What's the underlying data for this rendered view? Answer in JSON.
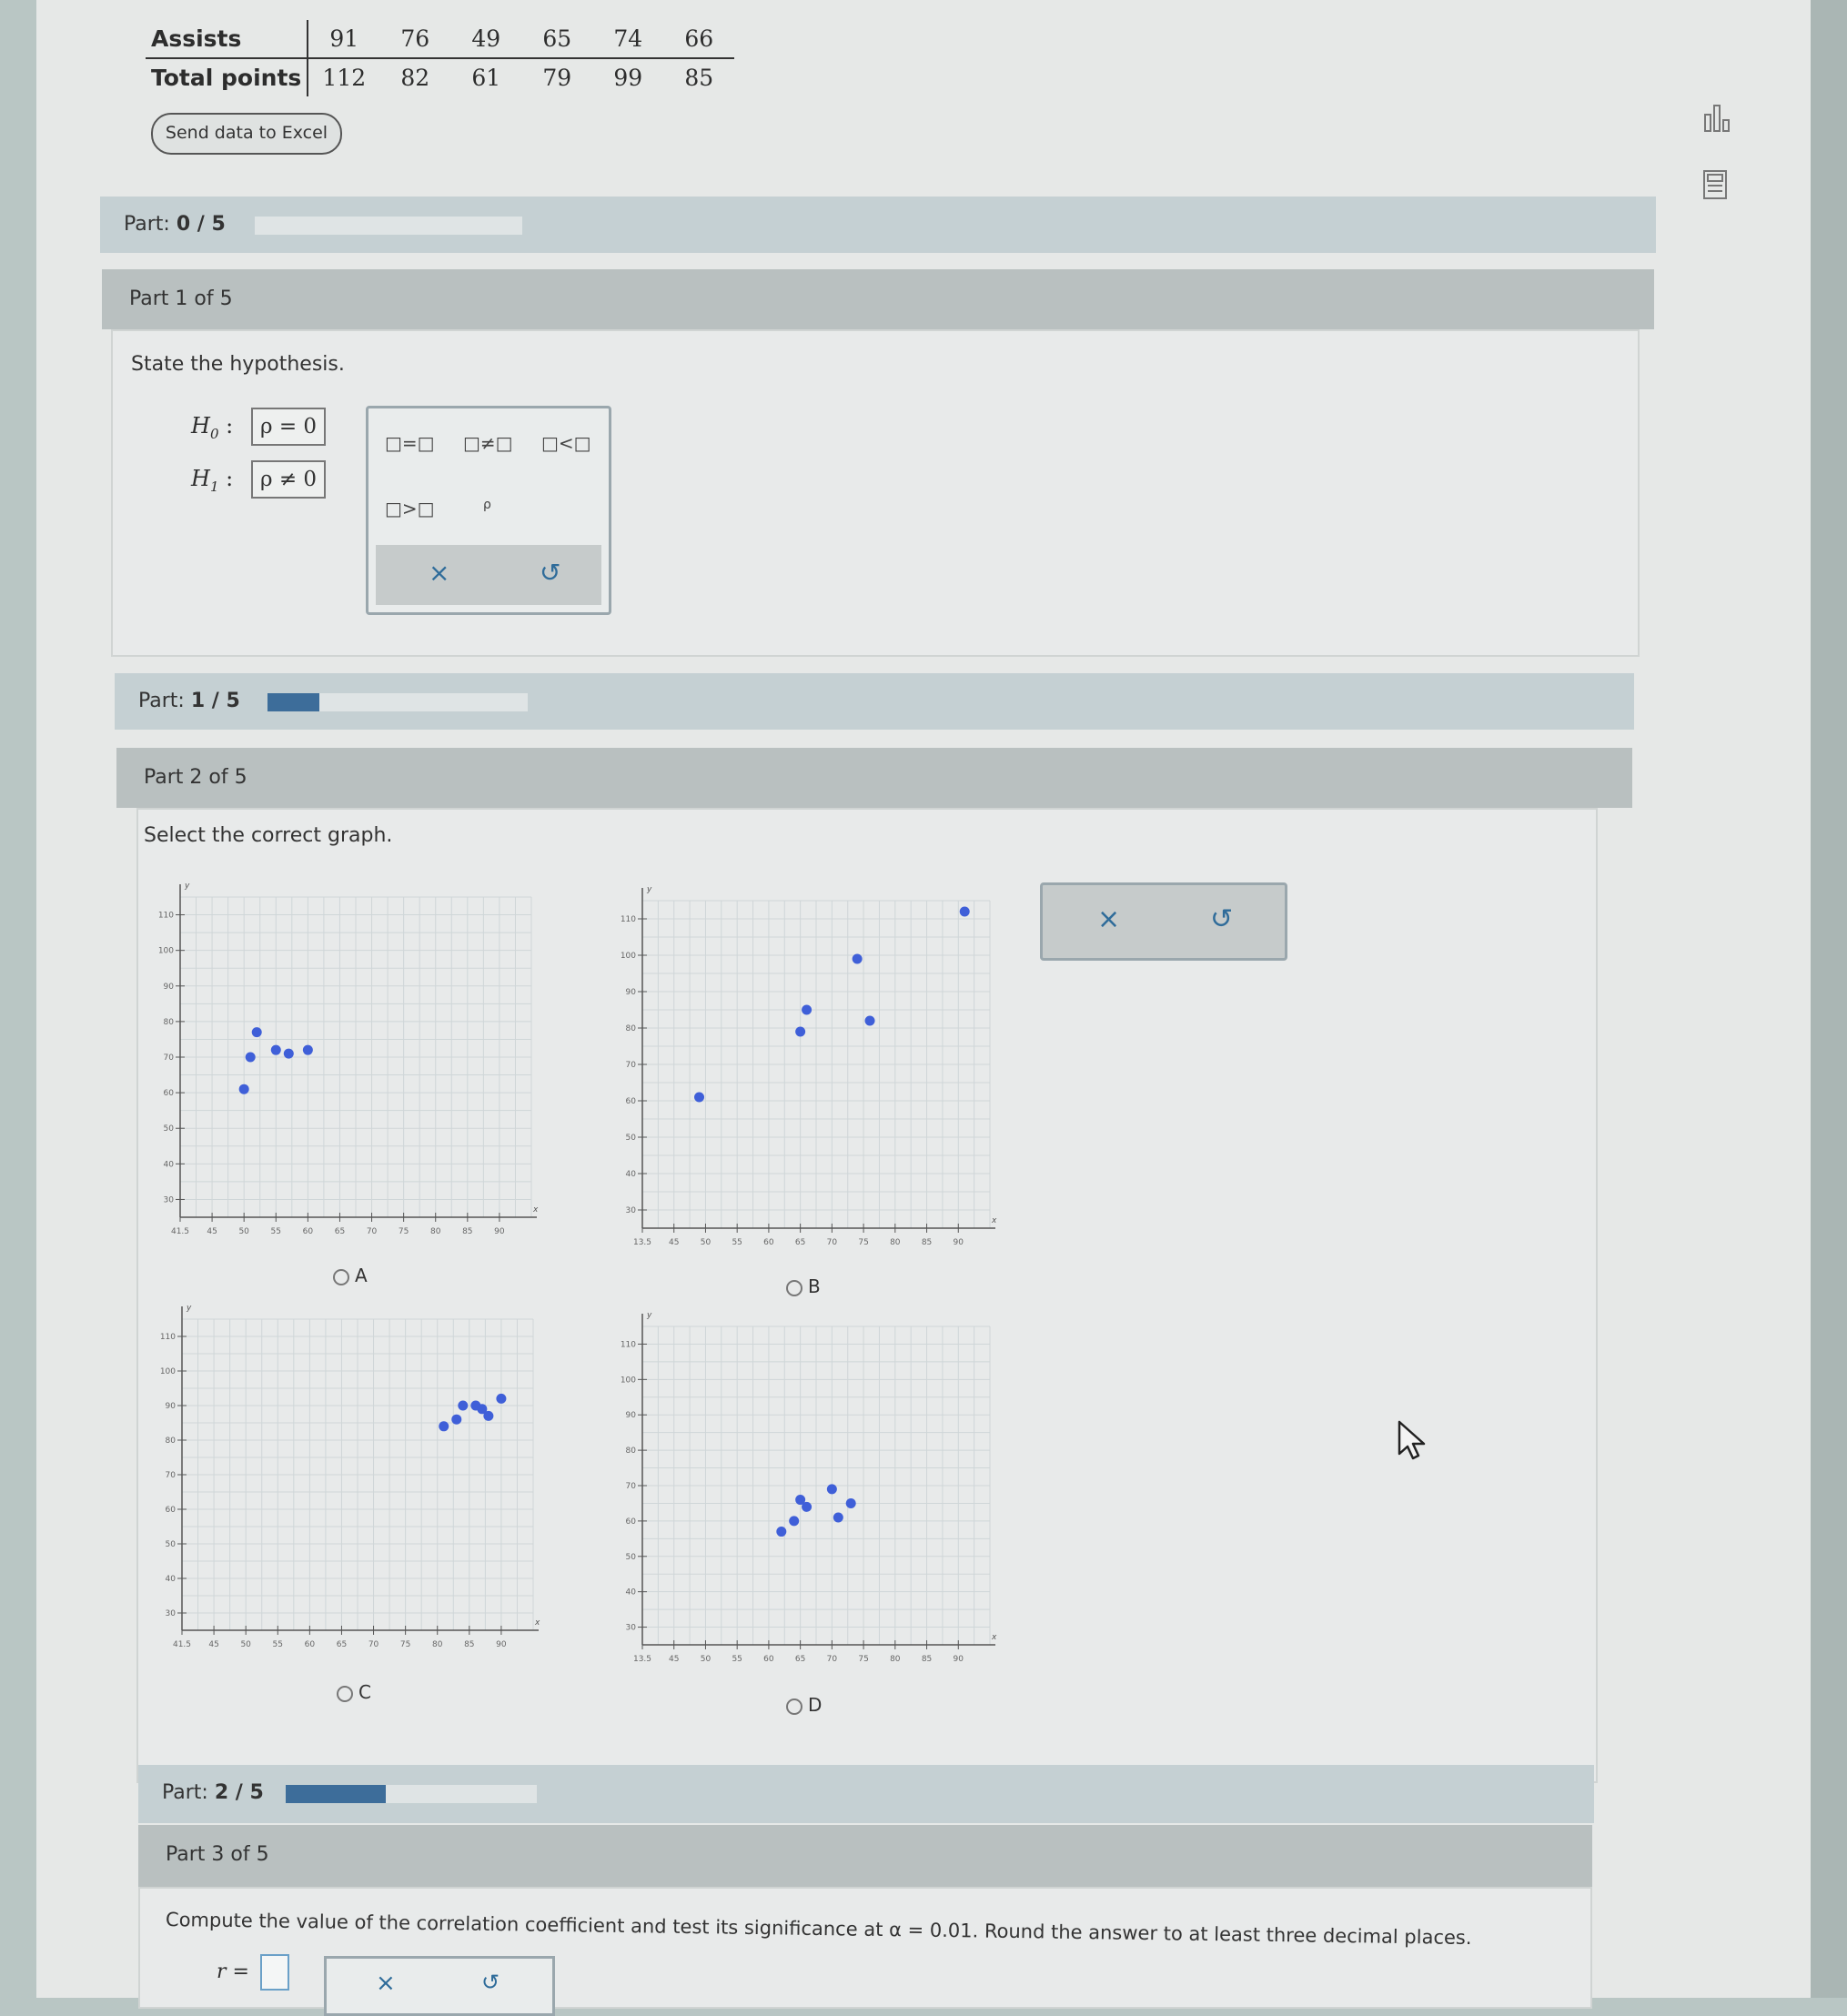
{
  "data_table": {
    "row1_label": "Assists",
    "row2_label": "Total points",
    "assists": [
      "91",
      "76",
      "49",
      "65",
      "74",
      "66"
    ],
    "total_points": [
      "112",
      "82",
      "61",
      "79",
      "99",
      "85"
    ]
  },
  "excel_button": "Send data to Excel",
  "progress": [
    {
      "prefix": "Part: ",
      "value": "0 / 5",
      "fraction": 0.0
    },
    {
      "prefix": "Part: ",
      "value": "1 / 5",
      "fraction": 0.2
    },
    {
      "prefix": "Part: ",
      "value": "2 / 5",
      "fraction": 0.4
    }
  ],
  "part1": {
    "header": "Part 1 of 5",
    "question": "State the hypothesis.",
    "h0_label": "H",
    "h0_sub": "0",
    "h0_value": "ρ = 0",
    "h1_label": "H",
    "h1_sub": "1",
    "h1_value": "ρ ≠ 0",
    "colon": ":",
    "palette": [
      "□=□",
      "□≠□",
      "□<□",
      "□>□",
      "ρ"
    ],
    "clear_icon": "×",
    "undo_icon": "↺"
  },
  "part2": {
    "header": "Part 2 of 5",
    "question": "Select the correct graph.",
    "clear_icon": "×",
    "undo_icon": "↺"
  },
  "part3": {
    "header": "Part 3 of 5",
    "question": "Compute the value of the correlation coefficient and test its significance at α = 0.01. Round the answer to at least three decimal places.",
    "r_label": "r =",
    "clear_icon": "×",
    "undo_icon": "↺"
  },
  "chart_data": [
    {
      "type": "scatter",
      "option": "A",
      "x_ticks": [
        "41.5",
        "45",
        "50",
        "55",
        "60",
        "65",
        "70",
        "75",
        "80",
        "85",
        "90"
      ],
      "y_ticks": [
        "30",
        "40",
        "50",
        "60",
        "70",
        "80",
        "90",
        "100",
        "110"
      ],
      "x_axis_label": "x",
      "y_axis_label": "y",
      "x": [
        50,
        51,
        52,
        55,
        57,
        60
      ],
      "y": [
        61,
        70,
        77,
        72,
        71,
        72
      ]
    },
    {
      "type": "scatter",
      "option": "B",
      "x_ticks": [
        "13.5",
        "45",
        "50",
        "55",
        "60",
        "65",
        "70",
        "75",
        "80",
        "85",
        "90"
      ],
      "y_ticks": [
        "30",
        "40",
        "50",
        "60",
        "70",
        "80",
        "90",
        "100",
        "110"
      ],
      "x_axis_label": "x",
      "y_axis_label": "y",
      "x": [
        49,
        65,
        66,
        74,
        76,
        91
      ],
      "y": [
        61,
        79,
        85,
        99,
        82,
        112
      ]
    },
    {
      "type": "scatter",
      "option": "C",
      "x_ticks": [
        "41.5",
        "45",
        "50",
        "55",
        "60",
        "65",
        "70",
        "75",
        "80",
        "85",
        "90"
      ],
      "y_ticks": [
        "30",
        "40",
        "50",
        "60",
        "70",
        "80",
        "90",
        "100",
        "110"
      ],
      "x_axis_label": "x",
      "y_axis_label": "y",
      "x": [
        81,
        83,
        84,
        86,
        87,
        88,
        90
      ],
      "y": [
        84,
        86,
        90,
        90,
        89,
        87,
        92
      ]
    },
    {
      "type": "scatter",
      "option": "D",
      "x_ticks": [
        "13.5",
        "45",
        "50",
        "55",
        "60",
        "65",
        "70",
        "75",
        "80",
        "85",
        "90"
      ],
      "y_ticks": [
        "30",
        "40",
        "50",
        "60",
        "70",
        "80",
        "90",
        "100",
        "110"
      ],
      "x_axis_label": "x",
      "y_axis_label": "y",
      "x": [
        62,
        64,
        65,
        66,
        70,
        71,
        73
      ],
      "y": [
        57,
        60,
        66,
        64,
        69,
        61,
        65
      ]
    }
  ],
  "colors": {
    "point": "#3f5fd8",
    "progress": "#3d6d9a",
    "accent": "#2f6c9a"
  }
}
